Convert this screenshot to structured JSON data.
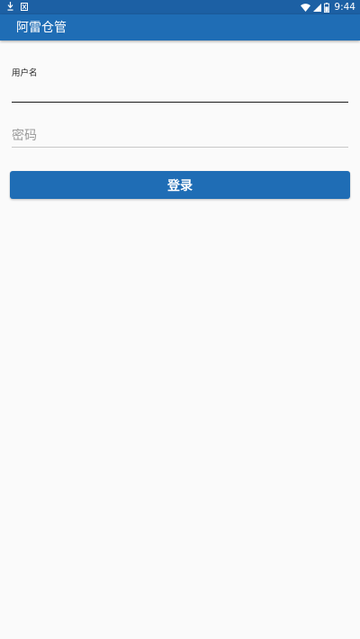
{
  "theme": {
    "primary": "#1f6db5",
    "primary_dark": "#1c60a4",
    "background": "#fafafa"
  },
  "status_bar": {
    "left_icons": [
      "download-icon",
      "app-notification-icon"
    ],
    "right_icons": [
      "wifi-icon",
      "signal-icon",
      "battery-icon"
    ],
    "time": "9:44"
  },
  "app_bar": {
    "title": "阿雷仓管"
  },
  "login_form": {
    "username": {
      "label": "用户名",
      "value": ""
    },
    "password": {
      "placeholder": "密码",
      "value": ""
    },
    "submit_label": "登录"
  }
}
